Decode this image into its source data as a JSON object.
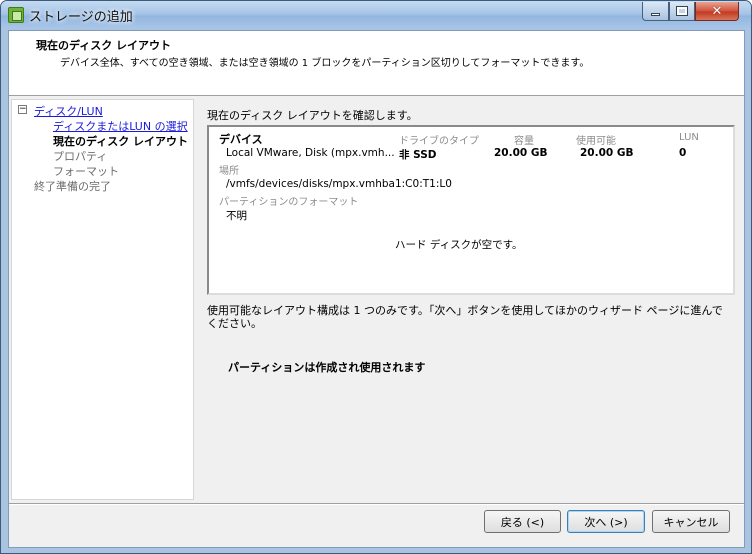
{
  "window": {
    "title": "ストレージの追加"
  },
  "header": {
    "title": "現在のディスク レイアウト",
    "subtitle": "デバイス全体、すべての空き領域、または空き領域の 1 ブロックをパーティション区切りしてフォーマットできます。"
  },
  "nav": {
    "group_label": "ディスク/LUN",
    "items": [
      {
        "label": "ディスクまたはLUN の選択",
        "state": "link"
      },
      {
        "label": "現在のディスク レイアウト",
        "state": "current"
      },
      {
        "label": "プロパティ",
        "state": "disabled"
      },
      {
        "label": "フォーマット",
        "state": "disabled"
      }
    ],
    "finish_label": "終了準備の完了"
  },
  "main": {
    "intro": "現在のディスク レイアウトを確認します。",
    "layout": {
      "columns": {
        "device": "デバイス",
        "drive_type": "ドライブのタイプ",
        "capacity": "容量",
        "available": "使用可能",
        "lun": "LUN"
      },
      "row": {
        "device": "Local VMware, Disk (mpx.vmh...",
        "drive_type": "非 SSD",
        "capacity": "20.00 GB",
        "available": "20.00 GB",
        "lun": "0"
      },
      "location_label": "場所",
      "location_value": "/vmfs/devices/disks/mpx.vmhba1:C0:T1:L0",
      "partition_format_label": "パーティションのフォーマット",
      "partition_format_value": "不明",
      "empty_message": "ハード ディスクが空です。"
    },
    "description": "使用可能なレイアウト構成は 1 つのみです。「次へ」ボタンを使用してほかのウィザード ページに進んでください。",
    "notice": "パーティションは作成され使用されます"
  },
  "footer": {
    "back_label": "戻る (<)",
    "next_label": "次へ (>)",
    "cancel_label": "キャンセル"
  },
  "icons": {
    "app": "storage-wizard-icon",
    "tree_toggle": "collapse-minus-icon"
  },
  "colors": {
    "titlebar": "#a6c4e6",
    "close_button": "#c13a20",
    "link": "#1a1adc",
    "disabled_text": "#6d6d6d"
  }
}
